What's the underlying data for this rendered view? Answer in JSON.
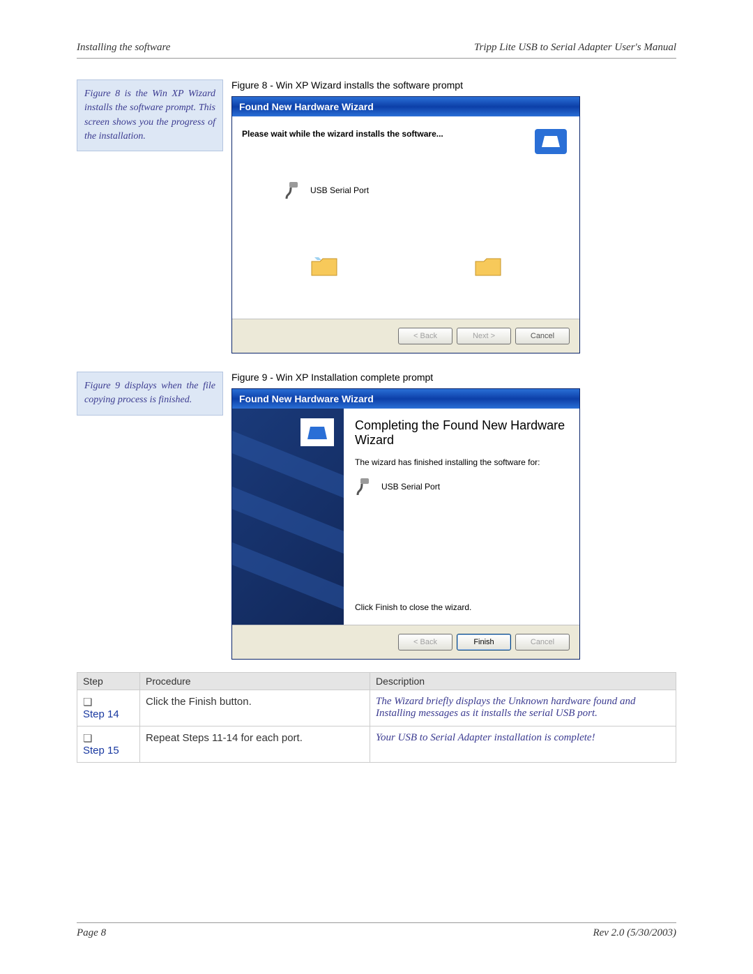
{
  "header": {
    "left": "Installing the software",
    "right": "Tripp Lite USB to Serial Adapter User's Manual"
  },
  "footer": {
    "left": "Page 8",
    "right": "Rev 2.0 (5/30/2003)"
  },
  "figure8": {
    "caption": "Figure 8 - Win XP Wizard installs the software prompt",
    "callout": "Figure 8 is the Win XP Wizard installs the software prompt. This screen shows you the progress of the installation.",
    "dialog": {
      "title": "Found New Hardware Wizard",
      "message": "Please wait while the wizard installs the software...",
      "device": "USB Serial Port",
      "buttons": {
        "back": "< Back",
        "next": "Next >",
        "cancel": "Cancel"
      }
    }
  },
  "figure9": {
    "caption": "Figure 9 - Win XP Installation complete prompt",
    "callout": "Figure 9 displays when the file copying process is finished.",
    "dialog": {
      "title": "Found New Hardware Wizard",
      "heading": "Completing the Found New Hardware Wizard",
      "subtext": "The wizard has finished installing the software for:",
      "device": "USB Serial Port",
      "click_finish": "Click Finish to close the wizard.",
      "buttons": {
        "back": "< Back",
        "finish": "Finish",
        "cancel": "Cancel"
      }
    }
  },
  "steps_table": {
    "headers": {
      "step": "Step",
      "procedure": "Procedure",
      "description": "Description"
    },
    "rows": [
      {
        "checkbox": "❏",
        "step": "Step 14",
        "procedure": "Click the Finish button.",
        "description": "The Wizard briefly displays the Unknown hardware found and Installing messages as it installs the serial USB port."
      },
      {
        "checkbox": "❏",
        "step": "Step 15",
        "procedure": "Repeat Steps 11-14 for each port.",
        "description": "Your USB to Serial Adapter installation is complete!"
      }
    ]
  }
}
